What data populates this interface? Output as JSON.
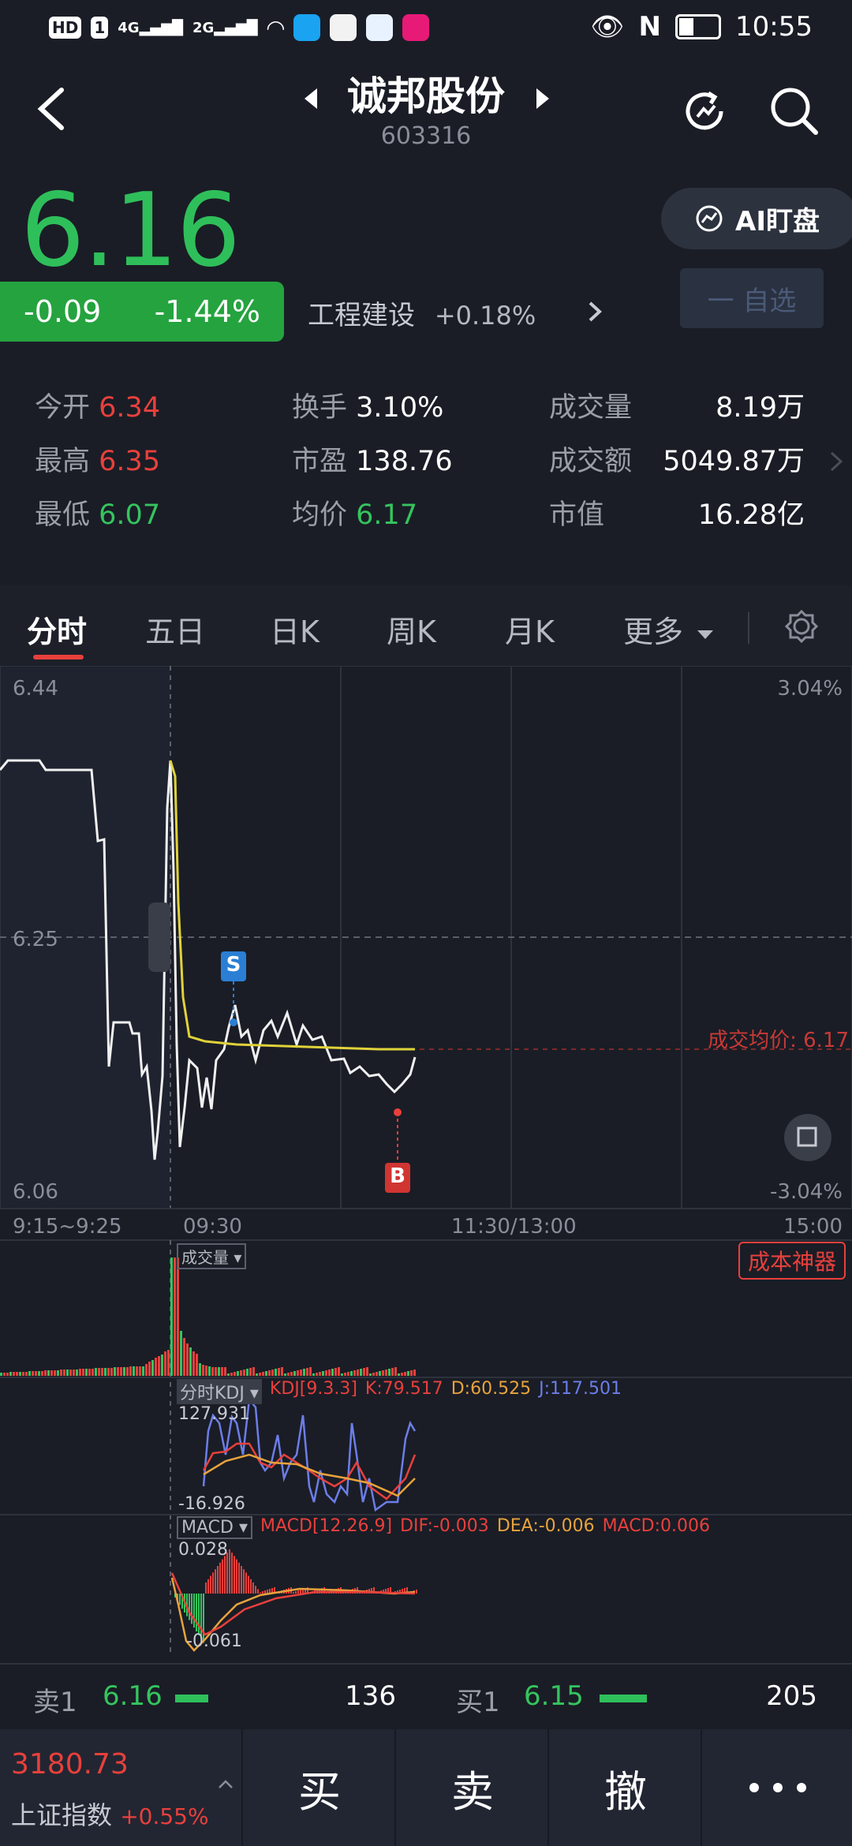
{
  "status": {
    "time": "10:55",
    "net1": "4G",
    "net2": "2G",
    "hd": "HD",
    "sim": "1"
  },
  "header": {
    "name": "诚邦股份",
    "code": "603316"
  },
  "quote": {
    "price": "6.16",
    "change": "-0.09",
    "change_pct": "-1.44%",
    "sector": "工程建设",
    "sector_chg": "+0.18%"
  },
  "buttons": {
    "ai": "AI盯盘",
    "watch": "一 自选"
  },
  "stats": {
    "open_label": "今开",
    "open": "6.34",
    "high_label": "最高",
    "high": "6.35",
    "low_label": "最低",
    "low": "6.07",
    "turnover_label": "换手",
    "turnover": "3.10%",
    "pe_label": "市盈",
    "pe": "138.76",
    "avg_label": "均价",
    "avg": "6.17",
    "vol_label": "成交量",
    "vol": "8.19万",
    "amt_label": "成交额",
    "amt": "5049.87万",
    "cap_label": "市值",
    "cap": "16.28亿"
  },
  "tabs": [
    "分时",
    "五日",
    "日K",
    "周K",
    "月K",
    "更多"
  ],
  "chart": {
    "y_top": "6.44",
    "y_mid": "6.25",
    "y_bot": "6.06",
    "pct_top": "3.04%",
    "pct_bot": "-3.04%",
    "avg_label": "成交均价: 6.17",
    "sell_marker": "S",
    "buy_marker": "B",
    "time_labels": [
      "9:15~9:25",
      "09:30",
      "11:30/13:00",
      "15:00"
    ],
    "vol_tag": "成交量",
    "cost_btn": "成本神器",
    "kdj_tag": "分时KDJ",
    "kdj_params": "KDJ[9.3.3]",
    "kdj_k": "K:79.517",
    "kdj_d": "D:60.525",
    "kdj_j": "J:117.501",
    "kdj_max": "127.931",
    "kdj_min": "-16.926",
    "macd_tag": "MACD",
    "macd_params": "MACD[12.26.9]",
    "macd_dif": "DIF:-0.003",
    "macd_dea": "DEA:-0.006",
    "macd_val": "MACD:0.006",
    "macd_max": "0.028",
    "macd_min": "-0.061"
  },
  "book": {
    "sell_label": "卖1",
    "sell_price": "6.16",
    "sell_qty": "136",
    "buy_label": "买1",
    "buy_price": "6.15",
    "buy_qty": "205"
  },
  "index": {
    "value": "3180.73",
    "name": "上证指数",
    "chg": "+0.55%"
  },
  "actions": {
    "buy": "买",
    "sell": "卖",
    "cancel": "撤"
  },
  "colors": {
    "up": "#e8403c",
    "down": "#35c45e",
    "avg_line": "#e0d23a",
    "bg": "#1a1d26"
  }
}
